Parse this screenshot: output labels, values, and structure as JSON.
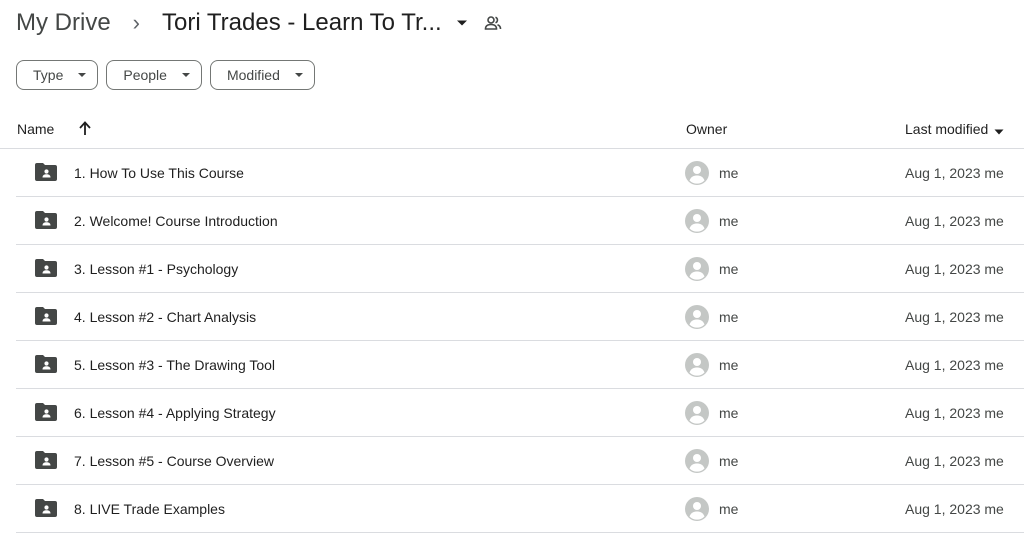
{
  "breadcrumb": {
    "root": "My Drive",
    "separator": "›",
    "current": "Tori Trades - Learn To Tr..."
  },
  "filters": [
    {
      "label": "Type"
    },
    {
      "label": "People"
    },
    {
      "label": "Modified"
    }
  ],
  "columns": {
    "name": "Name",
    "owner": "Owner",
    "last_modified": "Last modified"
  },
  "rows": [
    {
      "name": "1. How To Use This Course",
      "owner": "me",
      "modified": "Aug 1, 2023 me"
    },
    {
      "name": "2. Welcome! Course Introduction",
      "owner": "me",
      "modified": "Aug 1, 2023 me"
    },
    {
      "name": "3. Lesson #1 - Psychology",
      "owner": "me",
      "modified": "Aug 1, 2023 me"
    },
    {
      "name": "4. Lesson #2 - Chart Analysis",
      "owner": "me",
      "modified": "Aug 1, 2023 me"
    },
    {
      "name": "5. Lesson #3 - The Drawing Tool",
      "owner": "me",
      "modified": "Aug 1, 2023 me"
    },
    {
      "name": "6. Lesson #4 - Applying Strategy",
      "owner": "me",
      "modified": "Aug 1, 2023 me"
    },
    {
      "name": "7. Lesson #5 - Course Overview",
      "owner": "me",
      "modified": "Aug 1, 2023 me"
    },
    {
      "name": "8. LIVE Trade Examples",
      "owner": "me",
      "modified": "Aug 1, 2023 me"
    }
  ],
  "icons": {
    "folder": "shared-folder-icon",
    "owner": "avatar-icon",
    "sort": "arrow-up-icon",
    "dropdown": "caret-down-icon",
    "share": "people-icon"
  },
  "colors": {
    "text": "#1f1f1f",
    "secondary": "#444746",
    "divider": "#dadce0",
    "folder": "#444746",
    "avatar": "#c4c7c5"
  }
}
